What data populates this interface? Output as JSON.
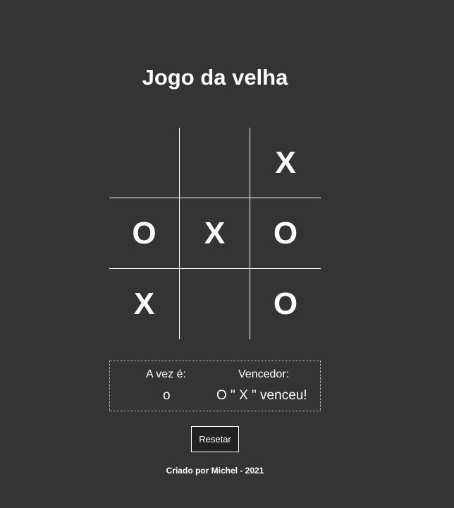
{
  "title": "Jogo da velha",
  "board": {
    "cells": [
      "",
      "",
      "X",
      "O",
      "X",
      "O",
      "X",
      "",
      "O"
    ]
  },
  "status": {
    "turn_label": "A vez é:",
    "turn_value": "o",
    "winner_label": "Vencedor:",
    "winner_value": "O \" X \" venceu!"
  },
  "reset_label": "Resetar",
  "footer": "Criado por Michel - 2021",
  "colors": {
    "background": "#343434",
    "text": "#ffffff",
    "button_bg": "#222222"
  }
}
